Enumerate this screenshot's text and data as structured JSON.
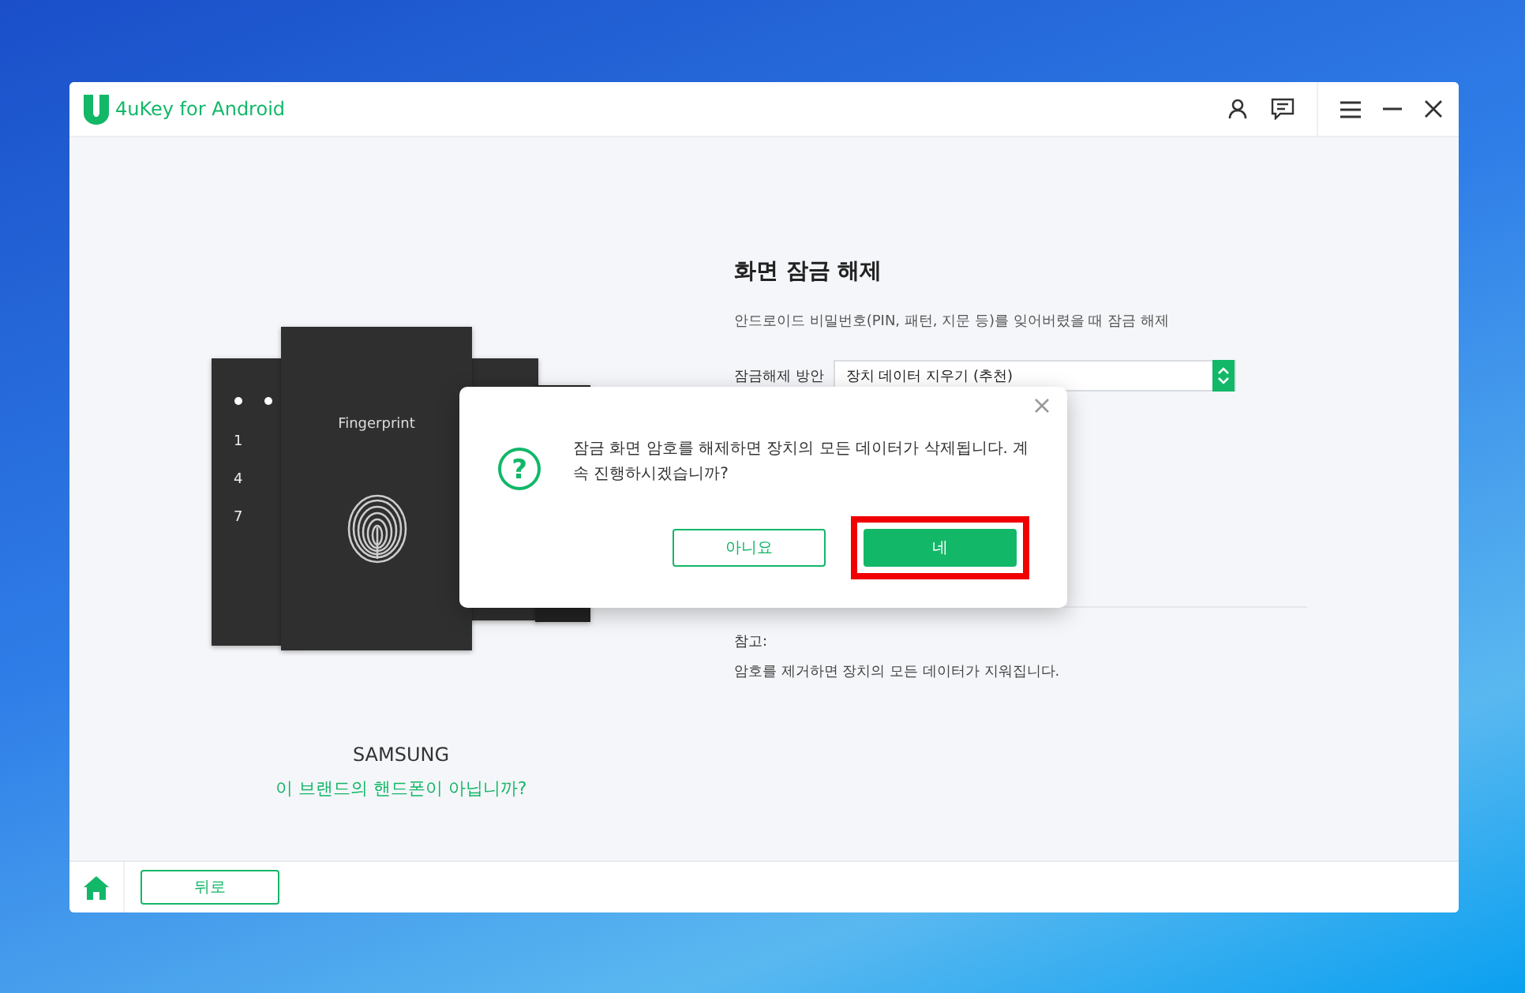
{
  "window": {
    "title": "4uKey for Android"
  },
  "device": {
    "card_label": "Fingerprint",
    "keypad_keys": [
      "1",
      "4",
      "7"
    ],
    "brand": "SAMSUNG",
    "wrong_brand_link": "이 브랜드의 핸드폰이 아닙니까?"
  },
  "panel": {
    "heading": "화면 잠금 해제",
    "description": "안드로이드 비밀번호(PIN, 패턴, 지문 등)를 잊어버렸을 때 잠금 해제",
    "method_label": "잠금해제 방안",
    "method_value": "장치 데이터 지우기 (추천)",
    "note_title": "참고:",
    "note_text": "암호를 제거하면 장치의 모든 데이터가 지워집니다."
  },
  "dialog": {
    "icon": "?",
    "message": "잠금 화면 암호를 해제하면 장치의 모든 데이터가 삭제됩니다. 계속 진행하시겠습니까?",
    "buttons": [
      {
        "label": "아니요",
        "kind": "secondary",
        "highlighted": false
      },
      {
        "label": "네",
        "kind": "primary",
        "highlighted": true
      }
    ]
  },
  "footer": {
    "back_button": "뒤로"
  }
}
